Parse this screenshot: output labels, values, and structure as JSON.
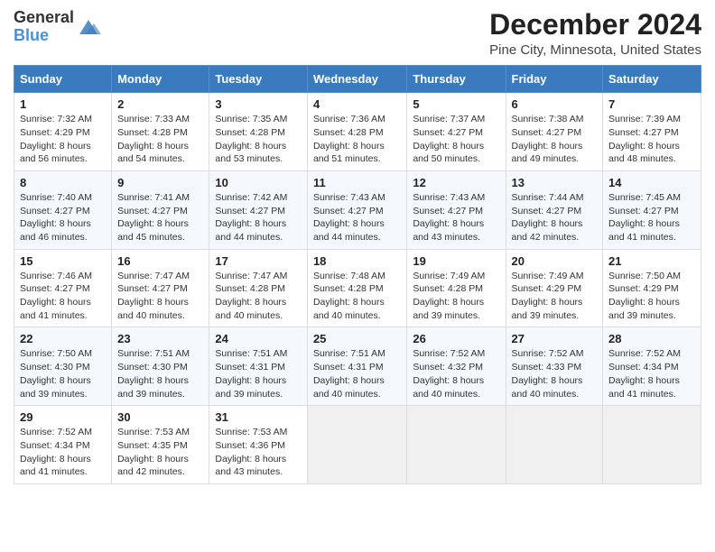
{
  "header": {
    "logo_general": "General",
    "logo_blue": "Blue",
    "month_title": "December 2024",
    "location": "Pine City, Minnesota, United States"
  },
  "days_of_week": [
    "Sunday",
    "Monday",
    "Tuesday",
    "Wednesday",
    "Thursday",
    "Friday",
    "Saturday"
  ],
  "weeks": [
    [
      {
        "day": "1",
        "sunrise": "7:32 AM",
        "sunset": "4:29 PM",
        "daylight": "8 hours and 56 minutes."
      },
      {
        "day": "2",
        "sunrise": "7:33 AM",
        "sunset": "4:28 PM",
        "daylight": "8 hours and 54 minutes."
      },
      {
        "day": "3",
        "sunrise": "7:35 AM",
        "sunset": "4:28 PM",
        "daylight": "8 hours and 53 minutes."
      },
      {
        "day": "4",
        "sunrise": "7:36 AM",
        "sunset": "4:28 PM",
        "daylight": "8 hours and 51 minutes."
      },
      {
        "day": "5",
        "sunrise": "7:37 AM",
        "sunset": "4:27 PM",
        "daylight": "8 hours and 50 minutes."
      },
      {
        "day": "6",
        "sunrise": "7:38 AM",
        "sunset": "4:27 PM",
        "daylight": "8 hours and 49 minutes."
      },
      {
        "day": "7",
        "sunrise": "7:39 AM",
        "sunset": "4:27 PM",
        "daylight": "8 hours and 48 minutes."
      }
    ],
    [
      {
        "day": "8",
        "sunrise": "7:40 AM",
        "sunset": "4:27 PM",
        "daylight": "8 hours and 46 minutes."
      },
      {
        "day": "9",
        "sunrise": "7:41 AM",
        "sunset": "4:27 PM",
        "daylight": "8 hours and 45 minutes."
      },
      {
        "day": "10",
        "sunrise": "7:42 AM",
        "sunset": "4:27 PM",
        "daylight": "8 hours and 44 minutes."
      },
      {
        "day": "11",
        "sunrise": "7:43 AM",
        "sunset": "4:27 PM",
        "daylight": "8 hours and 44 minutes."
      },
      {
        "day": "12",
        "sunrise": "7:43 AM",
        "sunset": "4:27 PM",
        "daylight": "8 hours and 43 minutes."
      },
      {
        "day": "13",
        "sunrise": "7:44 AM",
        "sunset": "4:27 PM",
        "daylight": "8 hours and 42 minutes."
      },
      {
        "day": "14",
        "sunrise": "7:45 AM",
        "sunset": "4:27 PM",
        "daylight": "8 hours and 41 minutes."
      }
    ],
    [
      {
        "day": "15",
        "sunrise": "7:46 AM",
        "sunset": "4:27 PM",
        "daylight": "8 hours and 41 minutes."
      },
      {
        "day": "16",
        "sunrise": "7:47 AM",
        "sunset": "4:27 PM",
        "daylight": "8 hours and 40 minutes."
      },
      {
        "day": "17",
        "sunrise": "7:47 AM",
        "sunset": "4:28 PM",
        "daylight": "8 hours and 40 minutes."
      },
      {
        "day": "18",
        "sunrise": "7:48 AM",
        "sunset": "4:28 PM",
        "daylight": "8 hours and 40 minutes."
      },
      {
        "day": "19",
        "sunrise": "7:49 AM",
        "sunset": "4:28 PM",
        "daylight": "8 hours and 39 minutes."
      },
      {
        "day": "20",
        "sunrise": "7:49 AM",
        "sunset": "4:29 PM",
        "daylight": "8 hours and 39 minutes."
      },
      {
        "day": "21",
        "sunrise": "7:50 AM",
        "sunset": "4:29 PM",
        "daylight": "8 hours and 39 minutes."
      }
    ],
    [
      {
        "day": "22",
        "sunrise": "7:50 AM",
        "sunset": "4:30 PM",
        "daylight": "8 hours and 39 minutes."
      },
      {
        "day": "23",
        "sunrise": "7:51 AM",
        "sunset": "4:30 PM",
        "daylight": "8 hours and 39 minutes."
      },
      {
        "day": "24",
        "sunrise": "7:51 AM",
        "sunset": "4:31 PM",
        "daylight": "8 hours and 39 minutes."
      },
      {
        "day": "25",
        "sunrise": "7:51 AM",
        "sunset": "4:31 PM",
        "daylight": "8 hours and 40 minutes."
      },
      {
        "day": "26",
        "sunrise": "7:52 AM",
        "sunset": "4:32 PM",
        "daylight": "8 hours and 40 minutes."
      },
      {
        "day": "27",
        "sunrise": "7:52 AM",
        "sunset": "4:33 PM",
        "daylight": "8 hours and 40 minutes."
      },
      {
        "day": "28",
        "sunrise": "7:52 AM",
        "sunset": "4:34 PM",
        "daylight": "8 hours and 41 minutes."
      }
    ],
    [
      {
        "day": "29",
        "sunrise": "7:52 AM",
        "sunset": "4:34 PM",
        "daylight": "8 hours and 41 minutes."
      },
      {
        "day": "30",
        "sunrise": "7:53 AM",
        "sunset": "4:35 PM",
        "daylight": "8 hours and 42 minutes."
      },
      {
        "day": "31",
        "sunrise": "7:53 AM",
        "sunset": "4:36 PM",
        "daylight": "8 hours and 43 minutes."
      },
      null,
      null,
      null,
      null
    ]
  ],
  "labels": {
    "sunrise": "Sunrise:",
    "sunset": "Sunset:",
    "daylight": "Daylight hours"
  }
}
